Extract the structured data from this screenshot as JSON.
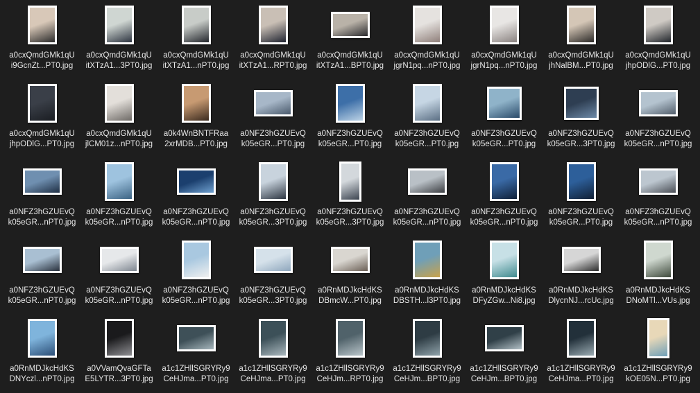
{
  "files": [
    {
      "line1": "a0cxQmdGMk1qU",
      "line2": "i9GcnZt...PT0.jpg",
      "shape": "portrait",
      "colors": [
        "#d8c8b8",
        "#2a2a2a"
      ]
    },
    {
      "line1": "a0cxQmdGMk1qU",
      "line2": "itXTzA1...3PT0.jpg",
      "shape": "portrait",
      "colors": [
        "#cfd6d2",
        "#2d3440"
      ]
    },
    {
      "line1": "a0cxQmdGMk1qU",
      "line2": "itXTzA1...nPT0.jpg",
      "shape": "portrait",
      "colors": [
        "#c8ccc8",
        "#23262c"
      ]
    },
    {
      "line1": "a0cxQmdGMk1qU",
      "line2": "itXTzA1...RPT0.jpg",
      "shape": "portrait",
      "colors": [
        "#c9bfb5",
        "#1f2330"
      ]
    },
    {
      "line1": "a0cxQmdGMk1qU",
      "line2": "itXTzA1...BPT0.jpg",
      "shape": "landscape",
      "colors": [
        "#b9b2a8",
        "#2b2b2e"
      ]
    },
    {
      "line1": "a0cxQmdGMk1qU",
      "line2": "jgrN1pq...nPT0.jpg",
      "shape": "portrait",
      "colors": [
        "#e5e2df",
        "#8f7f7a"
      ]
    },
    {
      "line1": "a0cxQmdGMk1qU",
      "line2": "jgrN1pq...nPT0.jpg",
      "shape": "portrait",
      "colors": [
        "#e8e6e4",
        "#8a8280"
      ]
    },
    {
      "line1": "a0cxQmdGMk1qU",
      "line2": "jhNalBM...PT0.jpg",
      "shape": "portrait",
      "colors": [
        "#d4c6b6",
        "#2c2a28"
      ]
    },
    {
      "line1": "a0cxQmdGMk1qU",
      "line2": "jhpODlG...PT0.jpg",
      "shape": "portrait",
      "colors": [
        "#cfcac4",
        "#20242a"
      ]
    },
    {
      "line1": "a0cxQmdGMk1qU",
      "line2": "jhpODlG...PT0.jpg",
      "shape": "portrait",
      "colors": [
        "#3a3f48",
        "#1a1d22"
      ]
    },
    {
      "line1": "a0cxQmdGMk1qU",
      "line2": "jlCM01z...nPT0.jpg",
      "shape": "portrait",
      "colors": [
        "#e3dfda",
        "#6e6a66"
      ]
    },
    {
      "line1": "a0k4WnBNTFRaa",
      "line2": "2xrMDB...PT0.jpg",
      "shape": "portrait",
      "colors": [
        "#c79a72",
        "#3a2a1e"
      ]
    },
    {
      "line1": "a0NFZ3hGZUEvQ",
      "line2": "k05eGR...PT0.jpg",
      "shape": "landscape",
      "colors": [
        "#a7b7c8",
        "#4a5a6c"
      ]
    },
    {
      "line1": "a0NFZ3hGZUEvQ",
      "line2": "k05eGR...PT0.jpg",
      "shape": "portrait",
      "colors": [
        "#3d6fa8",
        "#bcd3e6"
      ]
    },
    {
      "line1": "a0NFZ3hGZUEvQ",
      "line2": "k05eGR...PT0.jpg",
      "shape": "portrait",
      "colors": [
        "#c6d6e4",
        "#5b6f84"
      ]
    },
    {
      "line1": "a0NFZ3hGZUEvQ",
      "line2": "k05eGR...PT0.jpg",
      "shape": "square",
      "colors": [
        "#8fb3c9",
        "#2a4b6a"
      ]
    },
    {
      "line1": "a0NFZ3hGZUEvQ",
      "line2": "k05eGR...3PT0.jpg",
      "shape": "square",
      "colors": [
        "#2e3e52",
        "#6d8aa8"
      ]
    },
    {
      "line1": "a0NFZ3hGZUEvQ",
      "line2": "k05eGR...nPT0.jpg",
      "shape": "landscape",
      "colors": [
        "#b4c3cf",
        "#525e6b"
      ]
    },
    {
      "line1": "a0NFZ3hGZUEvQ",
      "line2": "k05eGR...nPT0.jpg",
      "shape": "landscape",
      "colors": [
        "#6f8fb0",
        "#1f2f44"
      ]
    },
    {
      "line1": "a0NFZ3hGZUEvQ",
      "line2": "k05eGR...nPT0.jpg",
      "shape": "portrait",
      "colors": [
        "#9ec3df",
        "#3d6484"
      ]
    },
    {
      "line1": "a0NFZ3hGZUEvQ",
      "line2": "k05eGR...nPT0.jpg",
      "shape": "landscape",
      "colors": [
        "#1b3f6e",
        "#6fa0cf"
      ]
    },
    {
      "line1": "a0NFZ3hGZUEvQ",
      "line2": "k05eGR...3PT0.jpg",
      "shape": "portrait",
      "colors": [
        "#c8d3dd",
        "#2e3642"
      ]
    },
    {
      "line1": "a0NFZ3hGZUEvQ",
      "line2": "k05eGR...3PT0.jpg",
      "shape": "tall",
      "colors": [
        "#d3d8dc",
        "#3c4450"
      ]
    },
    {
      "line1": "a0NFZ3hGZUEvQ",
      "line2": "k05eGR...nPT0.jpg",
      "shape": "landscape",
      "colors": [
        "#b9c0c6",
        "#3c3e42"
      ]
    },
    {
      "line1": "a0NFZ3hGZUEvQ",
      "line2": "k05eGR...nPT0.jpg",
      "shape": "portrait",
      "colors": [
        "#3a6aa6",
        "#0f2038"
      ]
    },
    {
      "line1": "a0NFZ3hGZUEvQ",
      "line2": "k05eGR...PT0.jpg",
      "shape": "portrait",
      "colors": [
        "#2d5f9a",
        "#112036"
      ]
    },
    {
      "line1": "a0NFZ3hGZUEvQ",
      "line2": "k05eGR...nPT0.jpg",
      "shape": "landscape",
      "colors": [
        "#bcc6cf",
        "#4a4e55"
      ]
    },
    {
      "line1": "a0NFZ3hGZUEvQ",
      "line2": "k05eGR...nPT0.jpg",
      "shape": "landscape",
      "colors": [
        "#a9bfd2",
        "#28303c"
      ]
    },
    {
      "line1": "a0NFZ3hGZUEvQ",
      "line2": "k05eGR...nPT0.jpg",
      "shape": "landscape",
      "colors": [
        "#e6e8ea",
        "#7e8690"
      ]
    },
    {
      "line1": "a0NFZ3hGZUEvQ",
      "line2": "k05eGR...nPT0.jpg",
      "shape": "portrait",
      "colors": [
        "#a9c8e0",
        "#f0f0f0"
      ]
    },
    {
      "line1": "a0NFZ3hGZUEvQ",
      "line2": "k05eGR...3PT0.jpg",
      "shape": "landscape",
      "colors": [
        "#d5e1ea",
        "#8fa7bd"
      ]
    },
    {
      "line1": "a0RnMDJkcHdKS",
      "line2": "DBmcW...PT0.jpg",
      "shape": "landscape",
      "colors": [
        "#d9d6d0",
        "#6b5f55"
      ]
    },
    {
      "line1": "a0RnMDJkcHdKS",
      "line2": "DBSTH...l3PT0.jpg",
      "shape": "portrait",
      "colors": [
        "#6f9fb8",
        "#c9a24a"
      ]
    },
    {
      "line1": "a0RnMDJkcHdKS",
      "line2": "DFyZGw...Ni8.jpg",
      "shape": "portrait",
      "colors": [
        "#c7e0e6",
        "#3e8a8e"
      ]
    },
    {
      "line1": "a0RnMDJkcHdKS",
      "line2": "DlycnNJ...rcUc.jpg",
      "shape": "landscape",
      "colors": [
        "#d6d6d6",
        "#2c2c2c"
      ]
    },
    {
      "line1": "a0RnMDJkcHdKS",
      "line2": "DNoMTl...VUs.jpg",
      "shape": "portrait",
      "colors": [
        "#cfd8cf",
        "#3f4a3c"
      ]
    },
    {
      "line1": "a0RnMDJkcHdKS",
      "line2": "DNYczl...nPT0.jpg",
      "shape": "portrait",
      "colors": [
        "#7fb4dc",
        "#2c4f78"
      ]
    },
    {
      "line1": "a0VVamQvaGFTa",
      "line2": "E5LYTR...3PT0.jpg",
      "shape": "portrait",
      "colors": [
        "#1a1a1c",
        "#8e8e92"
      ]
    },
    {
      "line1": "a1c1ZHllSGRYRy9",
      "line2": "CeHJma...PT0.jpg",
      "shape": "landscape",
      "colors": [
        "#3e5058",
        "#a6b6bc"
      ]
    },
    {
      "line1": "a1c1ZHllSGRYRy9",
      "line2": "CeHJma...PT0.jpg",
      "shape": "portrait",
      "colors": [
        "#3c5058",
        "#aab8be"
      ]
    },
    {
      "line1": "a1c1ZHllSGRYRy9",
      "line2": "CeHJm...RPT0.jpg",
      "shape": "portrait",
      "colors": [
        "#50626a",
        "#b9c5ca"
      ]
    },
    {
      "line1": "a1c1ZHllSGRYRy9",
      "line2": "CeHJm...BPT0.jpg",
      "shape": "portrait",
      "colors": [
        "#2e3c44",
        "#8fa2aa"
      ]
    },
    {
      "line1": "a1c1ZHllSGRYRy9",
      "line2": "CeHJm...BPT0.jpg",
      "shape": "landscape",
      "colors": [
        "#304048",
        "#b2c0c6"
      ]
    },
    {
      "line1": "a1c1ZHllSGRYRy9",
      "line2": "CeHJma...PT0.jpg",
      "shape": "portrait",
      "colors": [
        "#22303a",
        "#9aabb2"
      ]
    },
    {
      "line1": "a1c1ZHllSGRYRy9",
      "line2": "kOE05N...PT0.jpg",
      "shape": "tall",
      "colors": [
        "#e8d8b8",
        "#6fa0b8"
      ]
    }
  ]
}
